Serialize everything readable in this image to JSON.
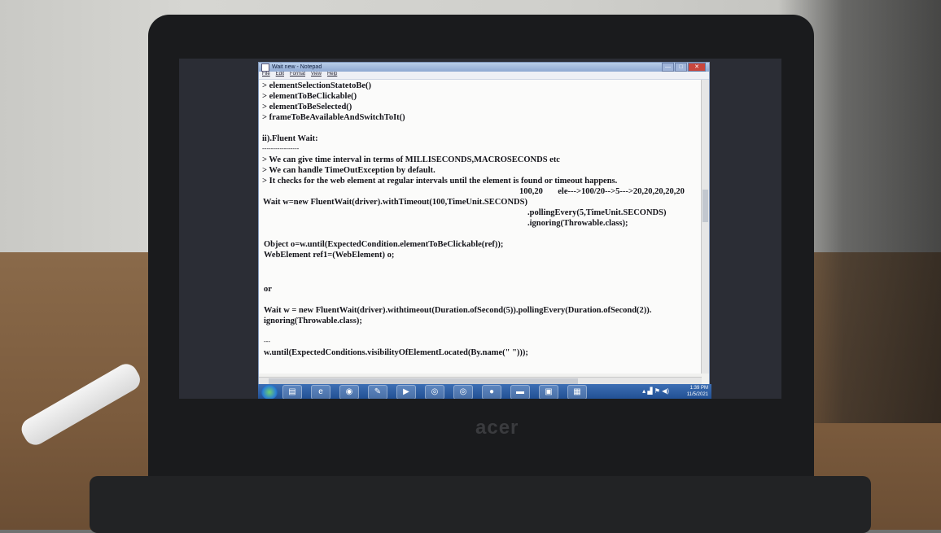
{
  "window": {
    "title": "Wait new - Notepad",
    "controls": {
      "minimize": "—",
      "maximize": "□",
      "close": "✕"
    }
  },
  "menu": [
    "File",
    "Edit",
    "Format",
    "View",
    "Help"
  ],
  "editor_lines": [
    "> elementSelectionStatetoBe()",
    "> elementToBeClickable()",
    "> elementToBeSelected()",
    "> frameToBeAvailableAndSwitchToIt()",
    "ii).Fluent Wait:",
    "-----------------",
    "> We can give time interval in terms of MILLISECONDS,MACROSECONDS etc",
    "> We can handle TimeOutException by default.",
    "> It checks for the web element at regular intervals until the element is found or timeout happens.",
    "100,20       ele--->100/20-->5--->20,20,20,20,20",
    "Wait w=new FluentWait(driver).withTimeout(100,TimeUnit.SECONDS)",
    ".pollingEvery(5,TimeUnit.SECONDS)",
    ".ignoring(Throwable.class);",
    "Object o=w.until(ExpectedCondition.elementToBeClickable(ref));",
    "WebElement ref1=(WebElement) o;",
    "or",
    "Wait w = new FluentWait(driver).withtimeout(Duration.ofSecond(5)).pollingEvery(Duration.ofSecond(2)).",
    "ignoring(Throwable.class);",
    "---",
    "w.until(ExpectedConditions.visibilityOfElementLocated(By.name(\" \")));"
  ],
  "taskbar": {
    "items": [
      "start-button",
      "file-explorer",
      "internet-explorer",
      "zoom",
      "paint",
      "media-player",
      "chrome-dev",
      "chrome",
      "firefox",
      "app-blue",
      "image-viewer",
      "notepad"
    ],
    "time": "1:39 PM",
    "date": "11/5/2021"
  },
  "laptop_brand": "acer"
}
